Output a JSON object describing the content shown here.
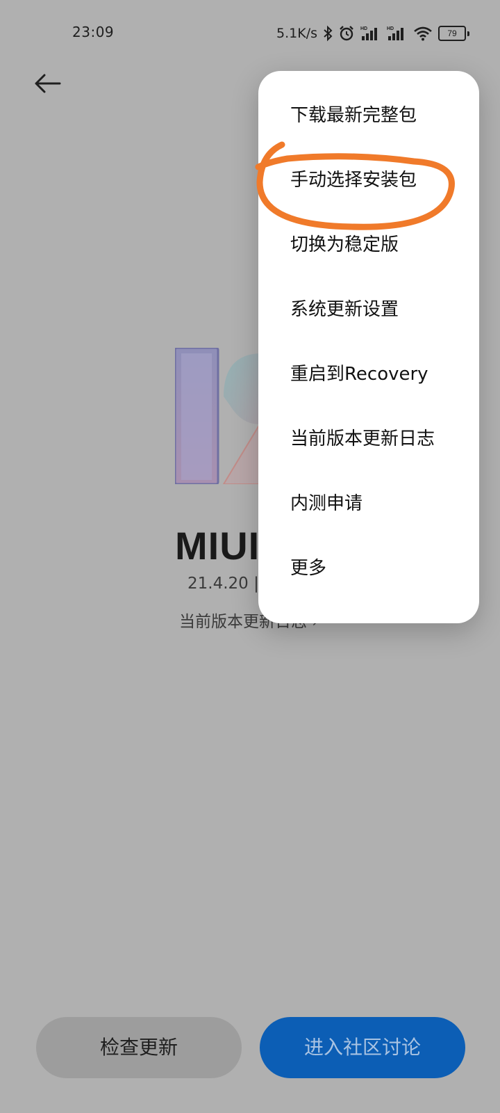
{
  "status_bar": {
    "time": "23:09",
    "net_speed": "5.1K/s",
    "battery_level": "79",
    "icons": [
      "bluetooth-icon",
      "alarm-icon",
      "hd-signal-icon",
      "hd-signal-icon",
      "wifi-icon",
      "battery-icon"
    ]
  },
  "header": {
    "back_icon": "arrow-left-icon"
  },
  "main": {
    "title": "MIUI",
    "version": "21.4.20 |",
    "changelog_link": "当前版本更新日志 ›"
  },
  "menu": {
    "items": [
      {
        "label": "下载最新完整包"
      },
      {
        "label": "手动选择安装包",
        "highlighted": true
      },
      {
        "label": "切换为稳定版"
      },
      {
        "label": "系统更新设置"
      },
      {
        "label": "重启到Recovery"
      },
      {
        "label": "当前版本更新日志"
      },
      {
        "label": "内测申请"
      },
      {
        "label": "更多"
      }
    ]
  },
  "buttons": {
    "check_update": "检查更新",
    "community": "进入社区讨论"
  },
  "colors": {
    "overlay_background": "#b0b0b0",
    "menu_background": "#ffffff",
    "annotation": "#f07a2a",
    "primary_button": "#0c5eb5",
    "secondary_button": "#9d9d9d"
  }
}
